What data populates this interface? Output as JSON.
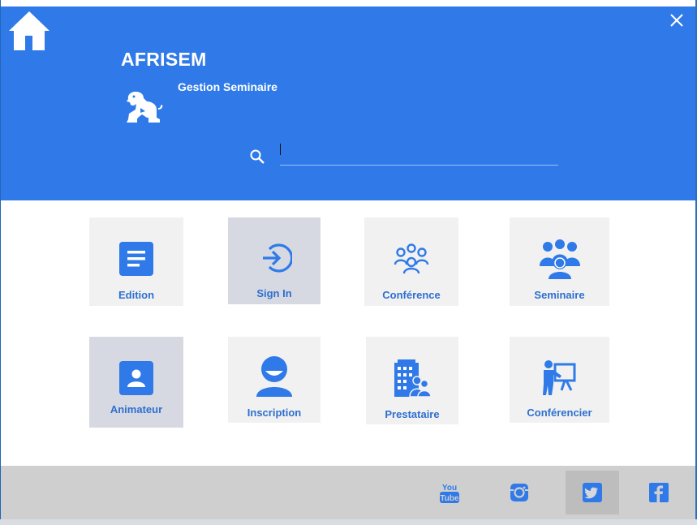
{
  "header": {
    "title": "AFRISEM",
    "subtitle": "Gestion Seminaire",
    "logo_icon": "lion-icon",
    "home_icon": "home-icon",
    "close_icon": "close-icon"
  },
  "search": {
    "icon": "search-icon",
    "value": "",
    "placeholder": ""
  },
  "tiles": [
    {
      "label": "Edition",
      "icon": "document-icon",
      "highlighted": false
    },
    {
      "label": "Sign In",
      "icon": "sign-in-icon",
      "highlighted": true
    },
    {
      "label": "Conférence",
      "icon": "group-icon",
      "highlighted": false
    },
    {
      "label": "Seminaire",
      "icon": "audience-icon",
      "highlighted": false
    },
    {
      "label": "Animateur",
      "icon": "contact-card-icon",
      "highlighted": true
    },
    {
      "label": "Inscription",
      "icon": "user-icon",
      "highlighted": false
    },
    {
      "label": "Prestataire",
      "icon": "buildings-icon",
      "highlighted": false
    },
    {
      "label": "Conférencier",
      "icon": "presenter-icon",
      "highlighted": false
    }
  ],
  "footer": {
    "social": [
      {
        "name": "YouTube",
        "icon": "youtube-icon",
        "highlighted": false
      },
      {
        "name": "Instagram",
        "icon": "instagram-icon",
        "highlighted": false
      },
      {
        "name": "Twitter",
        "icon": "twitter-icon",
        "highlighted": true
      },
      {
        "name": "Facebook",
        "icon": "facebook-icon",
        "highlighted": false
      }
    ]
  },
  "colors": {
    "header_bg": "#2f7ae8",
    "accent": "#2e6fcf",
    "tile_bg": "#f1f1f1",
    "tile_highlight_bg": "#d6d9e1",
    "footer_bg": "#cfcfcf"
  }
}
